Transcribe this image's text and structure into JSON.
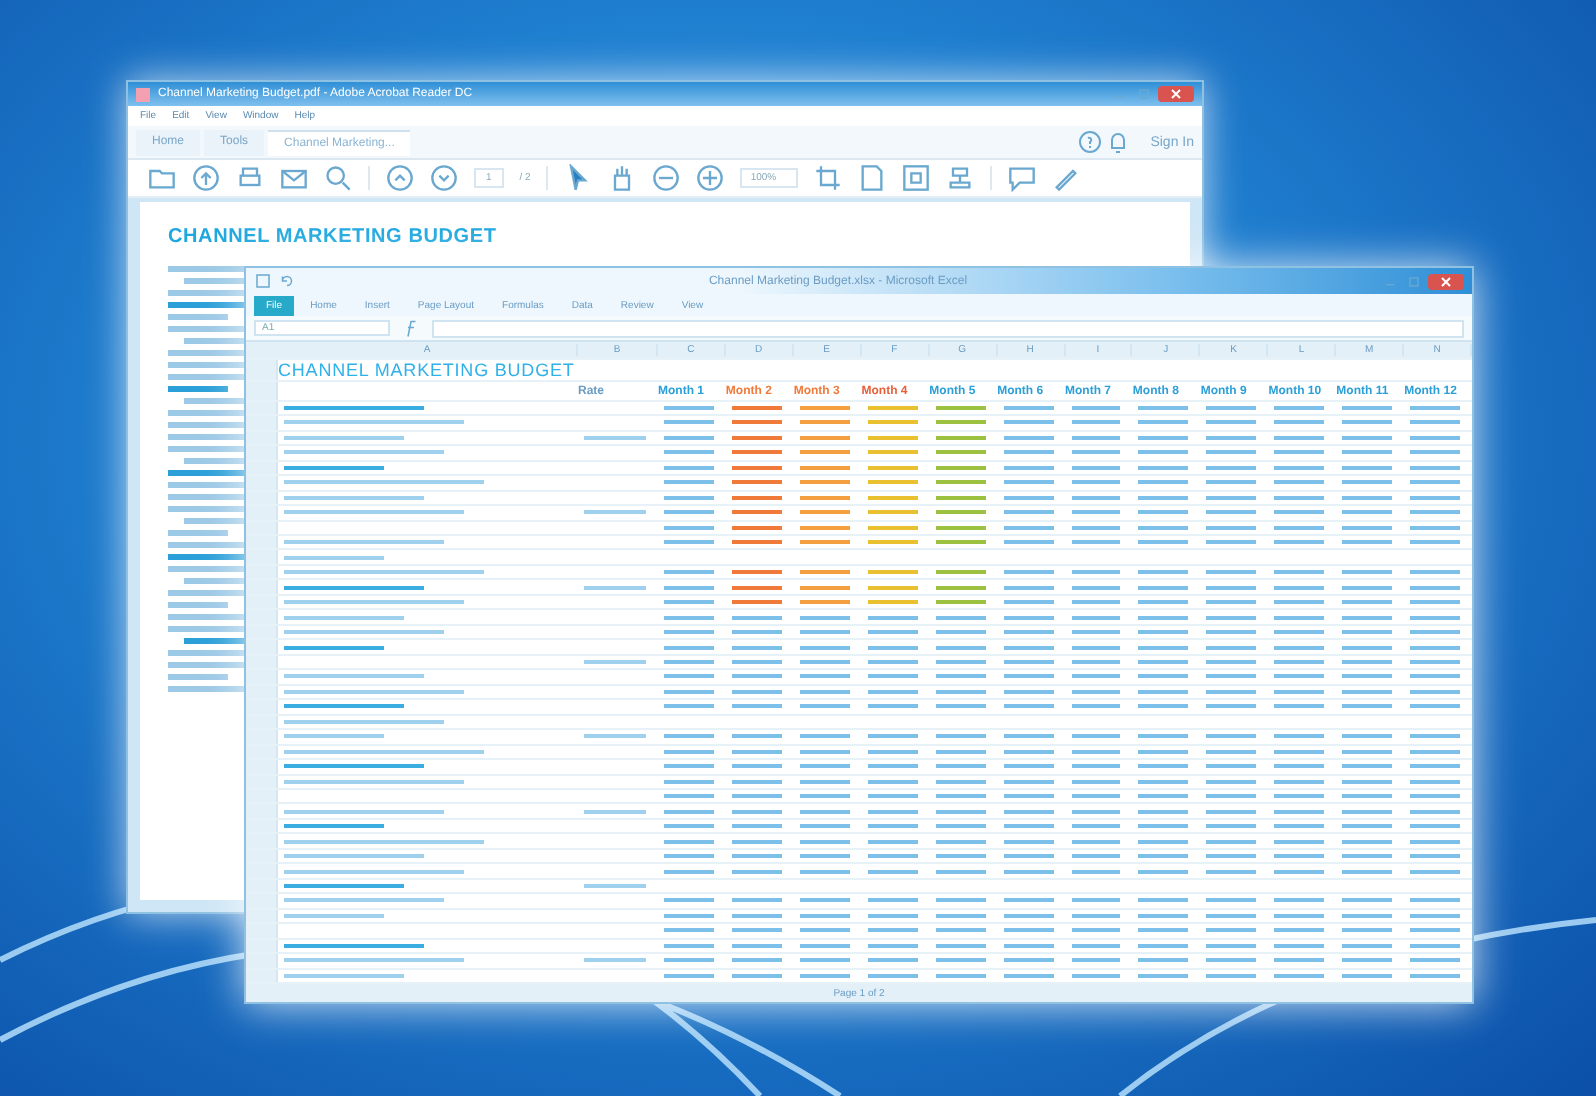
{
  "pdf_window": {
    "title": "Channel Marketing Budget.pdf - Adobe Acrobat Reader DC",
    "menu": [
      "File",
      "Edit",
      "View",
      "Window",
      "Help"
    ],
    "tabs": [
      {
        "label": "Home",
        "selected": false
      },
      {
        "label": "Tools",
        "selected": false
      },
      {
        "label": "Channel Marketing...",
        "selected": true
      }
    ],
    "sign_in": "Sign In",
    "page_field": "1",
    "page_count": "/ 2",
    "zoom": "100%",
    "document_title": "CHANNEL MARKETING BUDGET"
  },
  "excel_window": {
    "title": "Channel Marketing Budget.xlsx - Microsoft Excel",
    "ribbon_tabs": [
      {
        "label": "File",
        "selected": true
      },
      {
        "label": "Home",
        "selected": false
      },
      {
        "label": "Insert",
        "selected": false
      },
      {
        "label": "Page Layout",
        "selected": false
      },
      {
        "label": "Formulas",
        "selected": false
      },
      {
        "label": "Data",
        "selected": false
      },
      {
        "label": "Review",
        "selected": false
      },
      {
        "label": "View",
        "selected": false
      }
    ],
    "name_box": "A1",
    "columns": [
      "A",
      "B",
      "C",
      "D",
      "E",
      "F",
      "G",
      "H",
      "I",
      "J",
      "K",
      "L",
      "M",
      "N"
    ],
    "sheet_title": "CHANNEL MARKETING BUDGET",
    "rate_header": "Rate",
    "months": [
      {
        "label": "Month 1",
        "color": "#2a9fd8"
      },
      {
        "label": "Month 2",
        "color": "#f07a3a"
      },
      {
        "label": "Month 3",
        "color": "#f07a3a"
      },
      {
        "label": "Month 4",
        "color": "#e8603a"
      },
      {
        "label": "Month 5",
        "color": "#2a9fd8"
      },
      {
        "label": "Month 6",
        "color": "#2a9fd8"
      },
      {
        "label": "Month 7",
        "color": "#2a9fd8"
      },
      {
        "label": "Month 8",
        "color": "#2a9fd8"
      },
      {
        "label": "Month 9",
        "color": "#2a9fd8"
      },
      {
        "label": "Month 10",
        "color": "#2a9fd8"
      },
      {
        "label": "Month 11",
        "color": "#2a9fd8"
      },
      {
        "label": "Month 12",
        "color": "#2a9fd8"
      }
    ],
    "status": "Page 1 of 2"
  }
}
